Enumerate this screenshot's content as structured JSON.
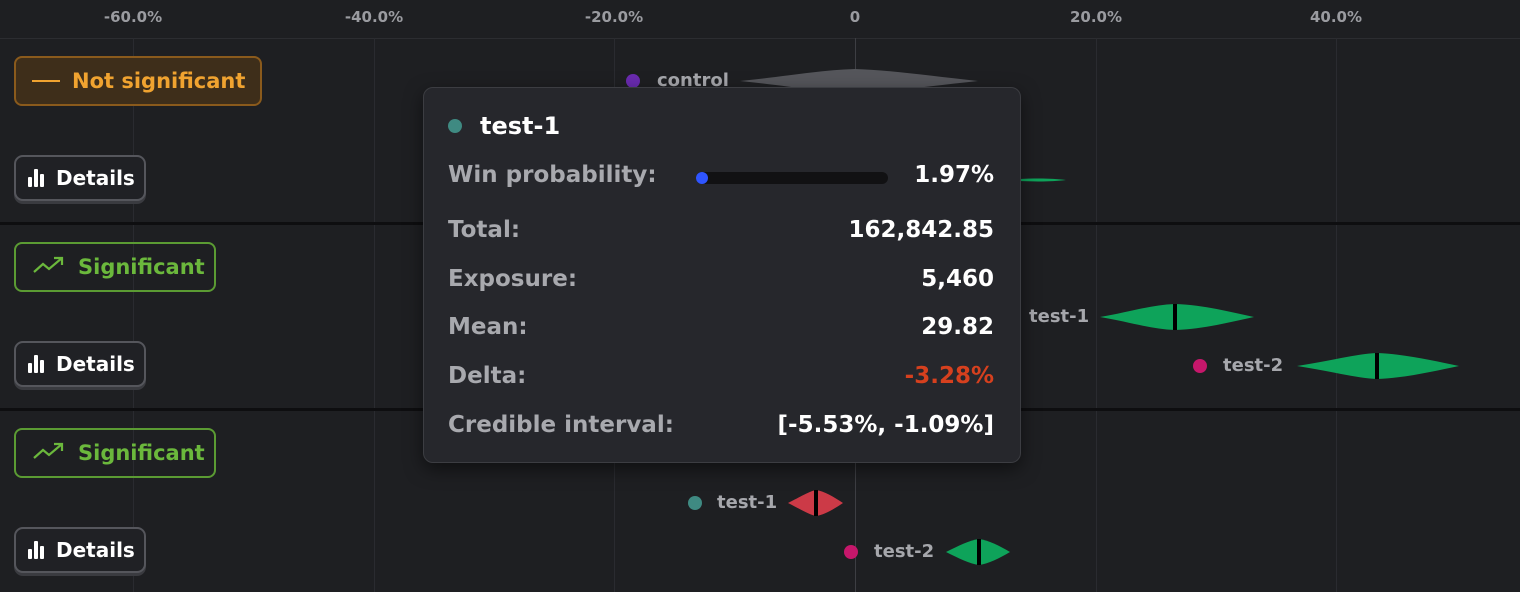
{
  "axis": {
    "ticks": [
      "-60.0%",
      "-40.0%",
      "-20.0%",
      "0",
      "20.0%",
      "40.0%"
    ]
  },
  "colors": {
    "control": "#6a2bb0",
    "test1": "#3f8a82",
    "test2": "#c6176b",
    "green": "#0ea35a",
    "red": "#cc3a47",
    "grey": "#5a5b60"
  },
  "groups": [
    {
      "status": {
        "label": "Not significant",
        "icon": "minus-icon"
      },
      "details_label": "Details",
      "variants": [
        {
          "name": "control"
        }
      ]
    },
    {
      "status": {
        "label": "Significant",
        "icon": "trending-up-icon"
      },
      "details_label": "Details",
      "variants": [
        {
          "name": "test-1"
        },
        {
          "name": "test-2"
        }
      ]
    },
    {
      "status": {
        "label": "Significant",
        "icon": "trending-up-icon"
      },
      "details_label": "Details",
      "variants": [
        {
          "name": "test-1"
        },
        {
          "name": "test-2"
        }
      ]
    }
  ],
  "tooltip": {
    "title": "test-1",
    "rows": [
      {
        "label": "Win probability:",
        "value": "1.97%"
      },
      {
        "label": "Total:",
        "value": "162,842.85"
      },
      {
        "label": "Exposure:",
        "value": "5,460"
      },
      {
        "label": "Mean:",
        "value": "29.82"
      },
      {
        "label": "Delta:",
        "value": "-3.28%"
      },
      {
        "label": "Credible interval:",
        "value": "[-5.53%, -1.09%]"
      }
    ],
    "win_probability_fraction": 0.0197
  }
}
